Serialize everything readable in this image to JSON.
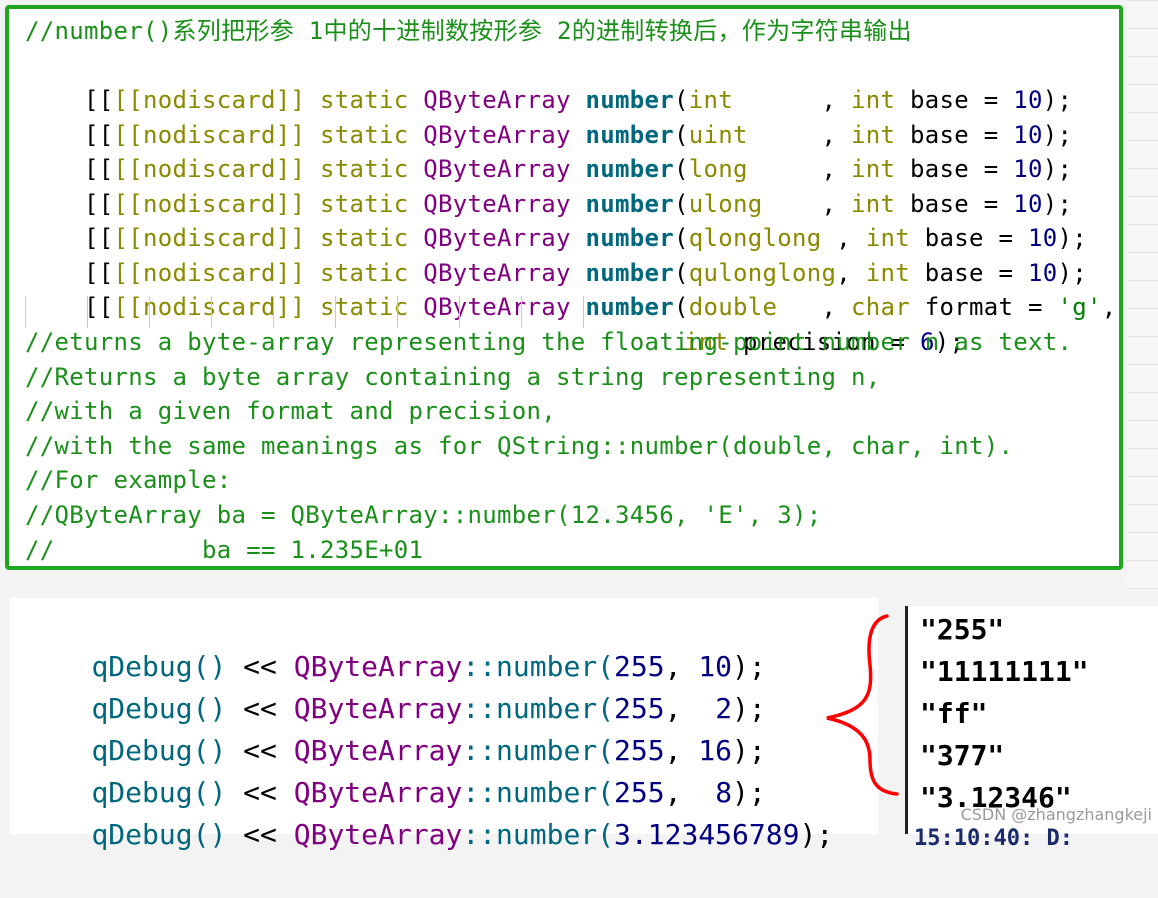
{
  "header": {
    "comment": "//number()系列把形参 1中的十进制数按形参 2的进制转换后，作为字符串输出"
  },
  "decls": [
    {
      "attr": "[[nodiscard]]",
      "kw": "static",
      "cls": "QByteArray",
      "fn": "number",
      "open": "(",
      "type": "int      ",
      "sep": ", ",
      "t2": "int",
      "name": " base = ",
      "val": "10",
      "end": ");"
    },
    {
      "attr": "[[nodiscard]]",
      "kw": "static",
      "cls": "QByteArray",
      "fn": "number",
      "open": "(",
      "type": "uint     ",
      "sep": ", ",
      "t2": "int",
      "name": " base = ",
      "val": "10",
      "end": ");"
    },
    {
      "attr": "[[nodiscard]]",
      "kw": "static",
      "cls": "QByteArray",
      "fn": "number",
      "open": "(",
      "type": "long     ",
      "sep": ", ",
      "t2": "int",
      "name": " base = ",
      "val": "10",
      "end": ");"
    },
    {
      "attr": "[[nodiscard]]",
      "kw": "static",
      "cls": "QByteArray",
      "fn": "number",
      "open": "(",
      "type": "ulong    ",
      "sep": ", ",
      "t2": "int",
      "name": " base = ",
      "val": "10",
      "end": ");"
    },
    {
      "attr": "[[nodiscard]]",
      "kw": "static",
      "cls": "QByteArray",
      "fn": "number",
      "open": "(",
      "type": "qlonglong ",
      "sep": ", ",
      "t2": "int",
      "name": " base = ",
      "val": "10",
      "end": ");"
    },
    {
      "attr": "[[nodiscard]]",
      "kw": "static",
      "cls": "QByteArray",
      "fn": "number",
      "open": "(",
      "type": "qulonglong",
      "sep": ", ",
      "t2": "int",
      "name": " base = ",
      "val": "10",
      "end": ");"
    },
    {
      "attr": "[[nodiscard]]",
      "kw": "static",
      "cls": "QByteArray",
      "fn": "number",
      "open": "(",
      "type": "double   ",
      "sep": ", ",
      "t2": "char",
      "name": " format = ",
      "val": "'g'",
      "end": ","
    }
  ],
  "continuation": {
    "t": "int",
    "name": " precision = ",
    "val": "6",
    "end": ");"
  },
  "comments": [
    "//eturns a byte-array representing the floating-point number n as text.",
    "//Returns a byte array containing a string representing n,",
    "//with a given format and precision,",
    "//with the same meanings as for QString::number(double, char, int).",
    "//For example:",
    "//QByteArray ba = QByteArray::number(12.3456, 'E', 3);",
    "//          ba == 1.235E+01"
  ],
  "calls": [
    {
      "fn": "qDebug()",
      "op": " << ",
      "cls": "QByteArray",
      "scope": "::number(",
      "a1": "255",
      "sep": ", ",
      "a2": "10",
      "end": ");"
    },
    {
      "fn": "qDebug()",
      "op": " << ",
      "cls": "QByteArray",
      "scope": "::number(",
      "a1": "255",
      "sep": ",  ",
      "a2": "2",
      "end": ");"
    },
    {
      "fn": "qDebug()",
      "op": " << ",
      "cls": "QByteArray",
      "scope": "::number(",
      "a1": "255",
      "sep": ", ",
      "a2": "16",
      "end": ");"
    },
    {
      "fn": "qDebug()",
      "op": " << ",
      "cls": "QByteArray",
      "scope": "::number(",
      "a1": "255",
      "sep": ",  ",
      "a2": "8",
      "end": ");"
    },
    {
      "fn": "qDebug()",
      "op": " << ",
      "cls": "QByteArray",
      "scope": "::number(",
      "a1": "3.123456789",
      "sep": "",
      "a2": "",
      "end": ");"
    }
  ],
  "outputs": [
    "\"255\"",
    "\"11111111\"",
    "\"ff\"",
    "\"377\"",
    "\"3.12346\""
  ],
  "watermark": "CSDN @zhangzhangkeji",
  "cutoff_text": "15:10:40: D:",
  "colors": {
    "border": "#1ea71e",
    "comment": "#1a8f1a",
    "brace": "#ff0000"
  }
}
